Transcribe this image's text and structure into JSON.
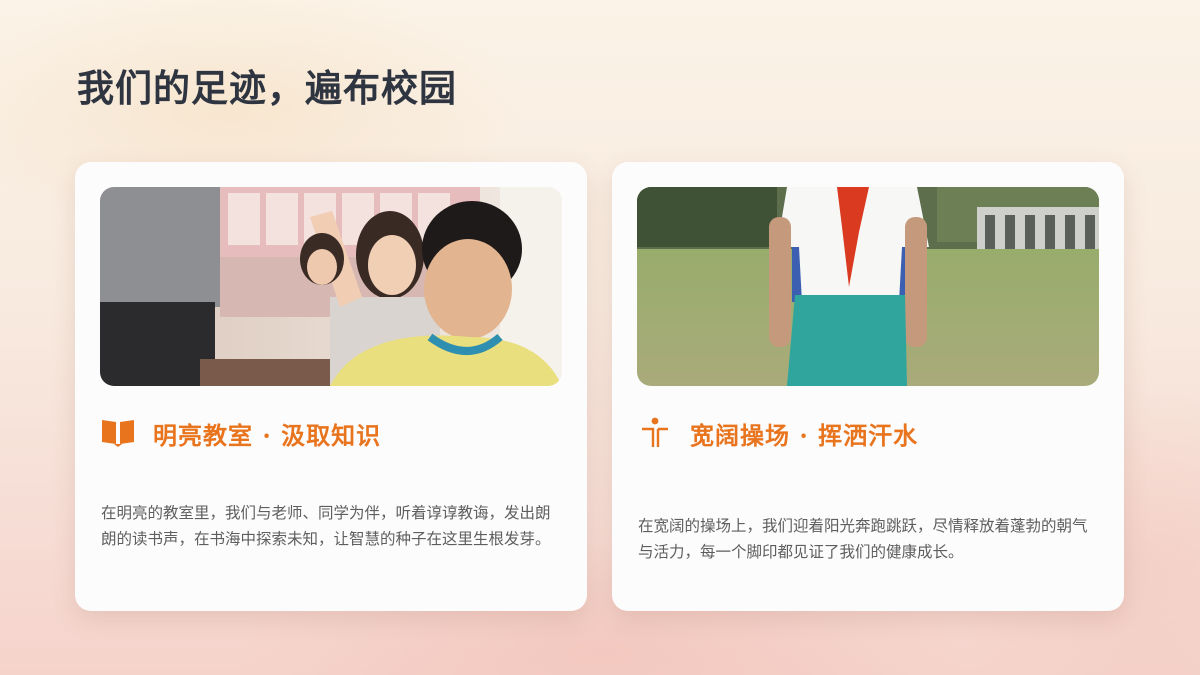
{
  "page": {
    "title": "我们的足迹，遍布校园"
  },
  "colors": {
    "accent": "#e8741e",
    "title_text": "#2f3540",
    "body_text": "#5e5e5e",
    "card_background": "#fdfcfc"
  },
  "cards": [
    {
      "icon": "open-book-icon",
      "photo": "classroom-students-photo",
      "heading": "明亮教室 · 汲取知识",
      "body": "在明亮的教室里，我们与老师、同学为伴，听着谆谆教诲，发出朗朗的读书声，在书海中探索未知，让智慧的种子在这里生根发芽。"
    },
    {
      "icon": "running-figure-icon",
      "photo": "playground-student-photo",
      "heading": "宽阔操场 · 挥洒汗水",
      "body": "在宽阔的操场上，我们迎着阳光奔跑跳跃，尽情释放着蓬勃的朝气与活力，每一个脚印都见证了我们的健康成长。"
    }
  ]
}
